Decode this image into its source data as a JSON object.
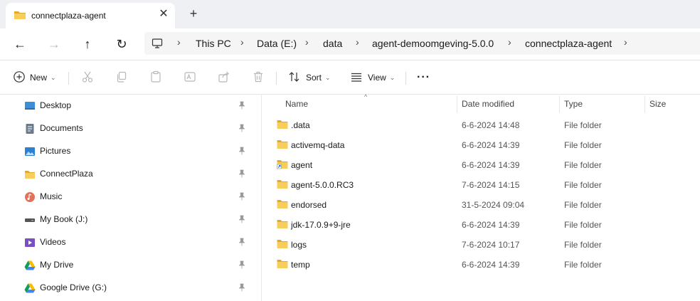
{
  "tab": {
    "title": "connectplaza-agent",
    "close_glyph": "✕",
    "new_tab_glyph": "+"
  },
  "nav": {
    "back_glyph": "←",
    "forward_glyph": "→",
    "up_glyph": "↑",
    "refresh_glyph": "↻",
    "breadcrumbs": [
      "This PC",
      "Data (E:)",
      "data",
      "agent-demoomgeving-5.0.0",
      "connectplaza-agent"
    ],
    "separator": "›"
  },
  "toolbar": {
    "new_label": "New",
    "sort_label": "Sort",
    "view_label": "View",
    "more_glyph": "···",
    "chevron": "⌄"
  },
  "sidebar": {
    "items": [
      {
        "label": "Desktop",
        "icon": "desktop-icon"
      },
      {
        "label": "Documents",
        "icon": "documents-icon"
      },
      {
        "label": "Pictures",
        "icon": "pictures-icon"
      },
      {
        "label": "ConnectPlaza",
        "icon": "folder-icon"
      },
      {
        "label": "Music",
        "icon": "music-icon"
      },
      {
        "label": "My Book (J:)",
        "icon": "drive-icon"
      },
      {
        "label": "Videos",
        "icon": "videos-icon"
      },
      {
        "label": "My Drive",
        "icon": "google-drive-icon"
      },
      {
        "label": "Google Drive (G:)",
        "icon": "google-drive-icon"
      }
    ]
  },
  "columns": {
    "name": "Name",
    "date": "Date modified",
    "type": "Type",
    "size": "Size",
    "sort_glyph": "^"
  },
  "files": [
    {
      "name": ".data",
      "date": "6-6-2024 14:48",
      "type": "File folder",
      "size": "",
      "shortcut": false
    },
    {
      "name": "activemq-data",
      "date": "6-6-2024 14:39",
      "type": "File folder",
      "size": "",
      "shortcut": false
    },
    {
      "name": "agent",
      "date": "6-6-2024 14:39",
      "type": "File folder",
      "size": "",
      "shortcut": true
    },
    {
      "name": "agent-5.0.0.RC3",
      "date": "7-6-2024 14:15",
      "type": "File folder",
      "size": "",
      "shortcut": false
    },
    {
      "name": "endorsed",
      "date": "31-5-2024 09:04",
      "type": "File folder",
      "size": "",
      "shortcut": false
    },
    {
      "name": "jdk-17.0.9+9-jre",
      "date": "6-6-2024 14:39",
      "type": "File folder",
      "size": "",
      "shortcut": false
    },
    {
      "name": "logs",
      "date": "7-6-2024 10:17",
      "type": "File folder",
      "size": "",
      "shortcut": false
    },
    {
      "name": "temp",
      "date": "6-6-2024 14:39",
      "type": "File folder",
      "size": "",
      "shortcut": false
    }
  ],
  "colors": {
    "folder": "#f2c14e",
    "folder_dark": "#e3a92f",
    "accent": "#0067c0",
    "tab_bg": "#eef0f4"
  }
}
